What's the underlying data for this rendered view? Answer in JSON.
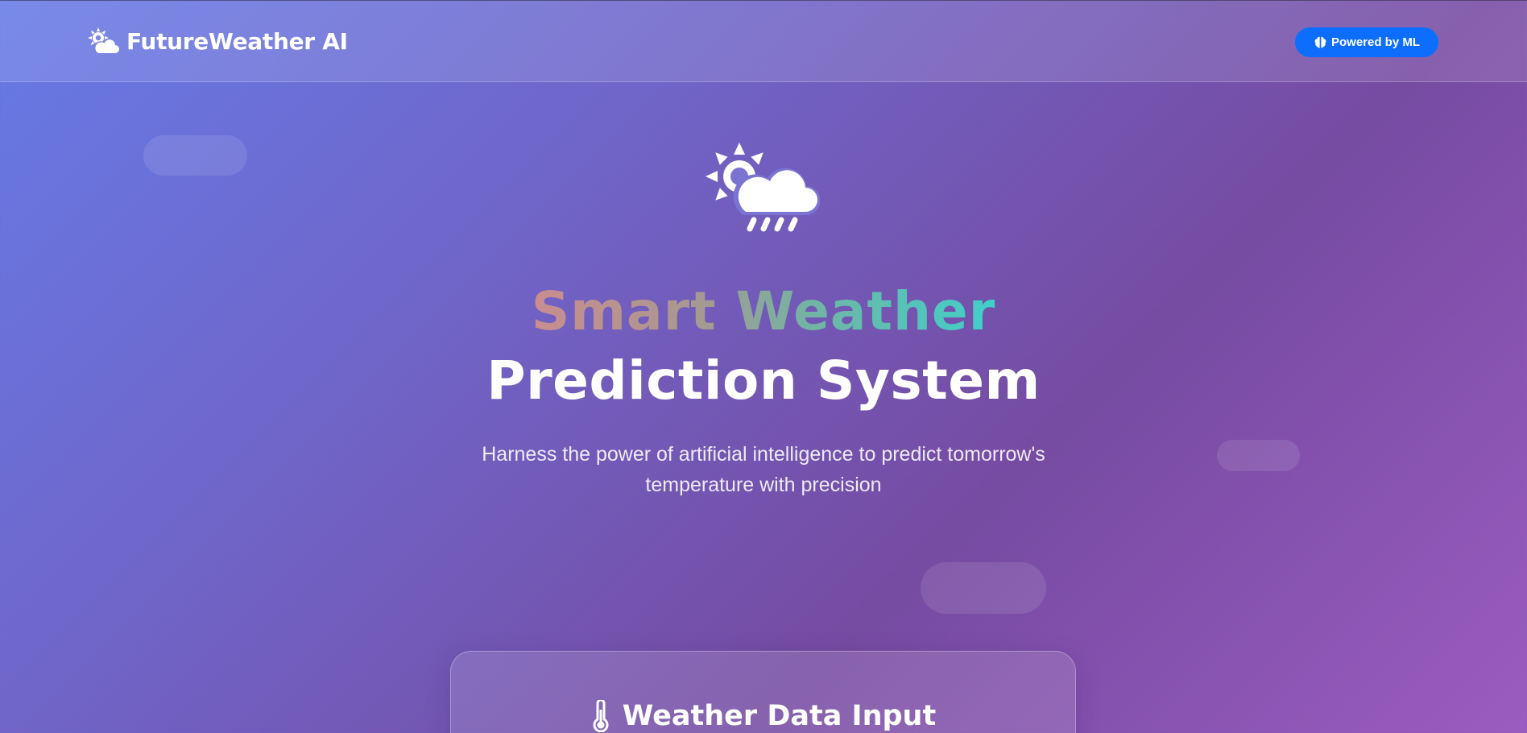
{
  "navbar": {
    "brand_name": "FutureWeather AI",
    "brand_icon": "sun-cloud-icon",
    "badge_label": "Powered by ML",
    "badge_icon": "brain-icon",
    "badge_color": "#0d6efd"
  },
  "hero": {
    "icon": "sun-cloud-rain-icon",
    "title_gradient": "Smart Weather",
    "title_plain": "Prediction System",
    "subtitle": "Harness the power of artificial intelligence to predict tomorrow's temperature with precision"
  },
  "input_card": {
    "icon": "thermometer-icon",
    "title": "Weather Data Input"
  },
  "colors": {
    "gradient_start": "#667ae6",
    "gradient_end": "#9b5cc0",
    "title_gradient_start": "#c98d8f",
    "title_gradient_end": "#3fd0c9"
  }
}
